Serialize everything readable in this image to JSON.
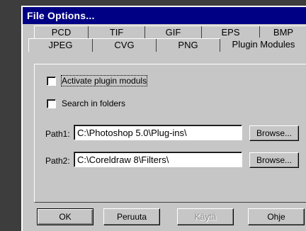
{
  "window": {
    "title": "File Options..."
  },
  "tabs": {
    "row1": [
      "PCD",
      "TIF",
      "GIF",
      "EPS",
      "BMP"
    ],
    "row2": [
      "JPEG",
      "CVG",
      "PNG",
      "Plugin Modules"
    ],
    "active": "Plugin Modules"
  },
  "options": {
    "activate_plugin_label": "Activate plugin moduls",
    "activate_plugin_checked": false,
    "search_folders_label": "Search in folders",
    "search_folders_checked": false
  },
  "paths": {
    "path1_label": "Path1:",
    "path1_value": "C:\\Photoshop 5.0\\Plug-ins\\",
    "path2_label": "Path2:",
    "path2_value": "C:\\Coreldraw 8\\Filters\\",
    "browse_label": "Browse..."
  },
  "buttons": {
    "ok": "OK",
    "cancel": "Peruuta",
    "apply": "Käytä",
    "help": "Ohje"
  }
}
